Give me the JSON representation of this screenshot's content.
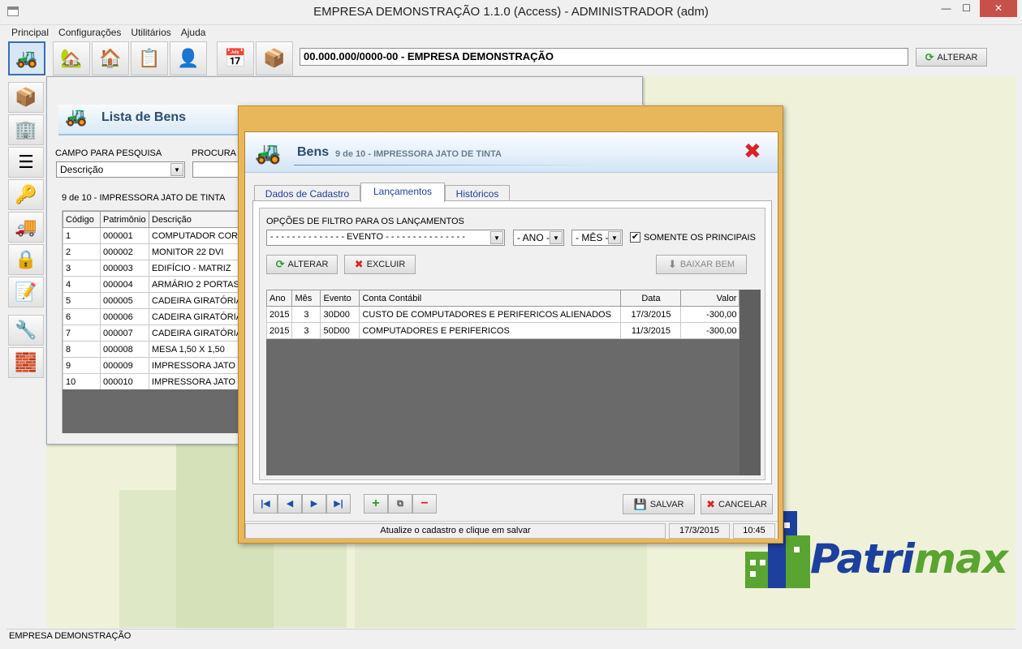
{
  "window": {
    "title": "EMPRESA DEMONSTRAÇÃO 1.1.0 (Access) - ADMINISTRADOR (adm)"
  },
  "menu": [
    "Principal",
    "Configurações",
    "Utilitários",
    "Ajuda"
  ],
  "toolbar": {
    "company": "00.000.000/0000-00 - EMPRESA DEMONSTRAÇÃO",
    "alterar_label": "ALTERAR"
  },
  "lista": {
    "title": "Lista de Bens",
    "search_field_label": "CAMPO PARA PESQUISA",
    "search_field_value": "Descrição",
    "search_text_label": "PROCURA P",
    "record_caption": "9 de 10 - IMPRESSORA JATO DE TINTA",
    "columns": [
      "Código",
      "Patrimônio",
      "Descrição"
    ],
    "rows": [
      [
        "1",
        "000001",
        "COMPUTADOR CORE I"
      ],
      [
        "2",
        "000002",
        "MONITOR 22 DVI"
      ],
      [
        "3",
        "000003",
        "EDIFÍCIO - MATRIZ"
      ],
      [
        "4",
        "000004",
        "ARMÁRIO 2 PORTAS"
      ],
      [
        "5",
        "000005",
        "CADEIRA GIRATÓRIA"
      ],
      [
        "6",
        "000006",
        "CADEIRA GIRATÓRIA"
      ],
      [
        "7",
        "000007",
        "CADEIRA GIRATÓRIA"
      ],
      [
        "8",
        "000008",
        "MESA 1,50 X 1,50"
      ],
      [
        "9",
        "000009",
        "IMPRESSORA JATO DE"
      ],
      [
        "10",
        "000010",
        "IMPRESSORA JATO DE"
      ]
    ]
  },
  "bens": {
    "title": "Bens",
    "subtitle": "9 de 10 - IMPRESSORA JATO DE TINTA",
    "tabs": [
      "Dados de Cadastro",
      "Lançamentos",
      "Históricos"
    ],
    "filter_label": "OPÇÕES DE FILTRO PARA OS LANÇAMENTOS",
    "evento_value": "- - - - - - - - - - - - - - EVENTO - - - - - - - - - - - - - - -",
    "ano_value": "- ANO -",
    "mes_value": "- MÊS -",
    "somente_label": "SOMENTE OS PRINCIPAIS",
    "alterar_label": "ALTERAR",
    "excluir_label": "EXCLUIR",
    "baixar_label": "BAIXAR BEM",
    "columns": [
      "Ano",
      "Mês",
      "Evento",
      "Conta Contábil",
      "Data",
      "Valor"
    ],
    "rows": [
      [
        "2015",
        "3",
        "30D00",
        "CUSTO DE COMPUTADORES E PERIFERICOS ALIENADOS",
        "17/3/2015",
        "-300,00"
      ],
      [
        "2015",
        "3",
        "50D00",
        "COMPUTADORES E PERIFERICOS",
        "11/3/2015",
        "-300,00"
      ]
    ],
    "salvar_label": "SALVAR",
    "cancelar_label": "CANCELAR",
    "status_message": "Atualize o cadastro e clique em salvar",
    "status_date": "17/3/2015",
    "status_time": "10:45"
  },
  "logo": {
    "part1": "Patri",
    "part2": "max"
  },
  "statusbar": {
    "text": "EMPRESA DEMONSTRAÇÃO"
  }
}
